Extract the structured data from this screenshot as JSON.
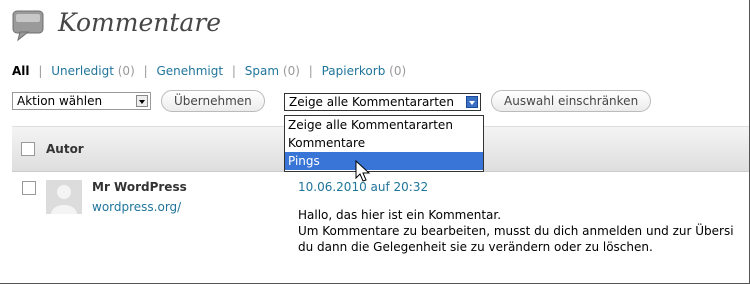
{
  "header": {
    "title": "Kommentare",
    "icon": "comments-icon"
  },
  "filters": [
    {
      "label": "All",
      "count": "",
      "current": true
    },
    {
      "label": "Unerledigt",
      "count": "(0)"
    },
    {
      "label": "Genehmigt",
      "count": ""
    },
    {
      "label": "Spam",
      "count": "(0)"
    },
    {
      "label": "Papierkorb",
      "count": "(0)"
    }
  ],
  "toolbar": {
    "action_select": "Aktion wählen",
    "apply_button": "Übernehmen",
    "type_select": "Zeige alle Kommentararten",
    "filter_button": "Auswahl einschränken"
  },
  "dropdown": {
    "options": [
      "Zeige alle Kommentararten",
      "Kommentare",
      "Pings"
    ],
    "highlighted": "Pings"
  },
  "table": {
    "column_author": "Autor",
    "rows": [
      {
        "author": "Mr WordPress",
        "url": "wordpress.org/",
        "date": "10.06.2010 auf 20:32",
        "text_lines": [
          "Hallo, das hier ist ein Kommentar.",
          "Um Kommentare zu bearbeiten, musst du dich anmelden und zur Übersi",
          "du dann die Gelegenheit sie zu verändern oder zu löschen."
        ]
      }
    ]
  },
  "colors": {
    "link": "#21759b",
    "highlight": "#3875d7"
  }
}
